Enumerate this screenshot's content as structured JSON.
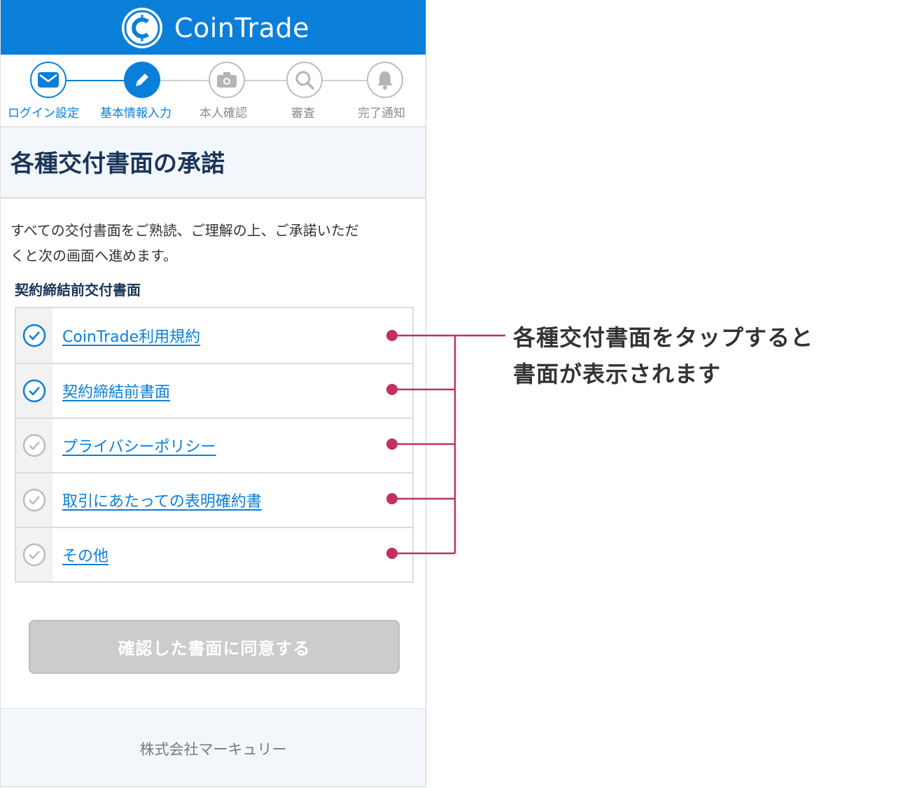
{
  "header": {
    "brand": "CoinTrade"
  },
  "steps": [
    {
      "label": "ログイン設定",
      "icon": "mail-icon",
      "state": "done"
    },
    {
      "label": "基本情報入力",
      "icon": "pencil-icon",
      "state": "current"
    },
    {
      "label": "本人確認",
      "icon": "camera-icon",
      "state": "pending"
    },
    {
      "label": "審査",
      "icon": "search-icon",
      "state": "pending"
    },
    {
      "label": "完了通知",
      "icon": "bell-icon",
      "state": "pending"
    }
  ],
  "page": {
    "title": "各種交付書面の承諾",
    "intro_line1": "すべての交付書面をご熟読、ご理解の上、ご承諾いただ",
    "intro_line2": "くと次の画面へ進めます。",
    "subhead": "契約締結前交付書面"
  },
  "documents": [
    {
      "label": "CoinTrade利用規約",
      "checked": true
    },
    {
      "label": "契約締結前書面",
      "checked": true
    },
    {
      "label": "プライバシーポリシー",
      "checked": false
    },
    {
      "label": "取引にあたっての表明確約書",
      "checked": false
    },
    {
      "label": "その他",
      "checked": false
    }
  ],
  "agree_button": {
    "label": "確認した書面に同意する",
    "disabled": true
  },
  "footer": {
    "company": "株式会社マーキュリー"
  },
  "annotation": {
    "line1": "各種交付書面をタップすると",
    "line2": "書面が表示されます"
  },
  "colors": {
    "brand_blue": "#0a7fd9",
    "callout": "#c0325d",
    "pending_gray": "#bdbdbd"
  }
}
